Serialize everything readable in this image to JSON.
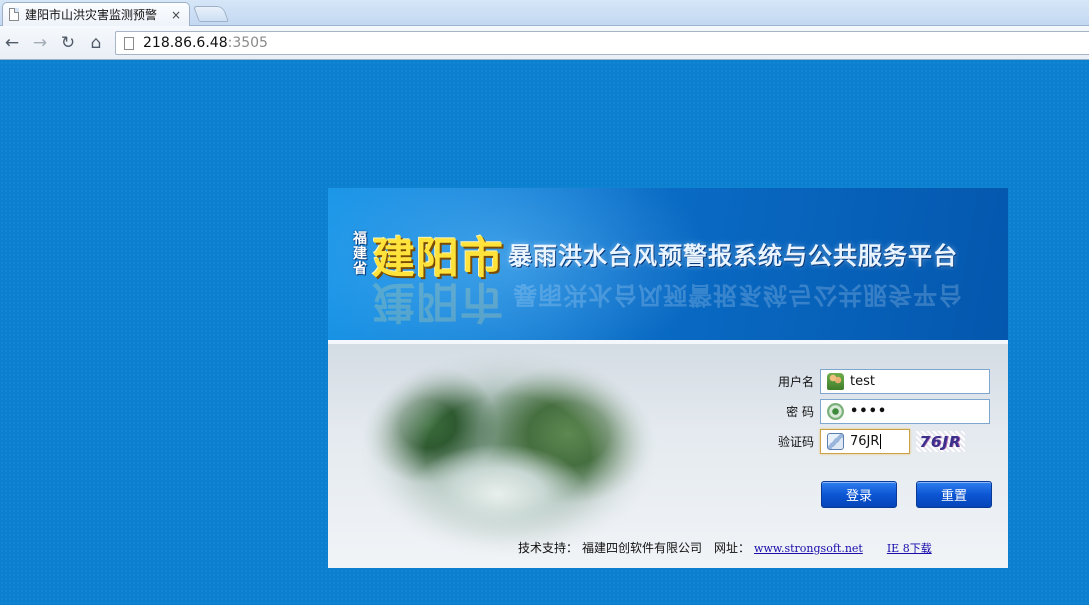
{
  "browser": {
    "tab_title": "建阳市山洪灾害监测预警",
    "tab_close": "×",
    "url_host": "218.86.6.48",
    "url_port": ":3505",
    "back_glyph": "←",
    "forward_glyph": "→",
    "reload_glyph": "↻",
    "home_glyph": "⌂"
  },
  "banner": {
    "province": "福建省",
    "city": "建阳市",
    "system_name": "暴雨洪水台风预警报系统与公共服务平台"
  },
  "form": {
    "username_label": "用户名",
    "username_value": "test",
    "password_label": "密 码",
    "password_value": "••••",
    "captcha_label": "验证码",
    "captcha_value": "76JR",
    "captcha_image_text": "76JR",
    "login_button": "登录",
    "reset_button": "重置"
  },
  "footer": {
    "support_label": "技术支持：",
    "company": "福建四创软件有限公司",
    "site_label": "网址：",
    "site_link": "www.strongsoft.net",
    "ie_link": "IE 8下载"
  },
  "icons": [
    "page-icon",
    "close-icon",
    "back-arrow-icon",
    "forward-arrow-icon",
    "reload-icon",
    "home-icon",
    "user-icon",
    "lock-icon",
    "captcha-icon"
  ],
  "colors": {
    "page_background": "#0b80cf",
    "banner_blue": "#0a6cc6",
    "city_title_yellow": "#ffe23a",
    "button_blue": "#0d56d4",
    "link_blue": "#1a0dab"
  }
}
